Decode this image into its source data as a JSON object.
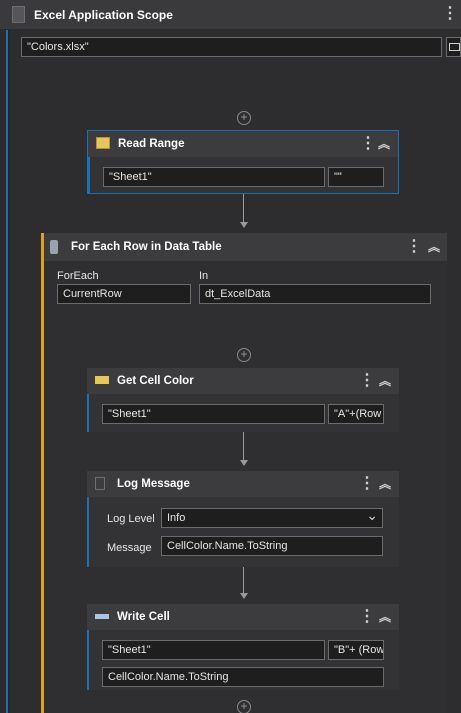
{
  "scope": {
    "title": "Excel Application Scope",
    "file_path": "\"Colors.xlsx\""
  },
  "read_range": {
    "title": "Read Range",
    "sheet": "\"Sheet1\"",
    "range": "\"\""
  },
  "for_each": {
    "title": "For Each Row in Data Table",
    "foreach_label": "ForEach",
    "foreach_value": "CurrentRow",
    "in_label": "In",
    "in_value": "dt_ExcelData"
  },
  "get_cell_color": {
    "title": "Get Cell Color",
    "sheet": "\"Sheet1\"",
    "cell": "\"A\"+(Row"
  },
  "log_message": {
    "title": "Log Message",
    "level_label": "Log Level",
    "level_value": "Info",
    "message_label": "Message",
    "message_value": "CellColor.Name.ToString"
  },
  "write_cell": {
    "title": "Write Cell",
    "sheet": "\"Sheet1\"",
    "cell": "\"B\"+ (Row",
    "value": "CellColor.Name.ToString"
  },
  "icons": {
    "more": "⋮",
    "collapse": "︽",
    "add": "+",
    "dropdown": "⌄"
  },
  "colors": {
    "selected_accent": "#1f6fb5",
    "foreach_accent": "#e0a020"
  }
}
